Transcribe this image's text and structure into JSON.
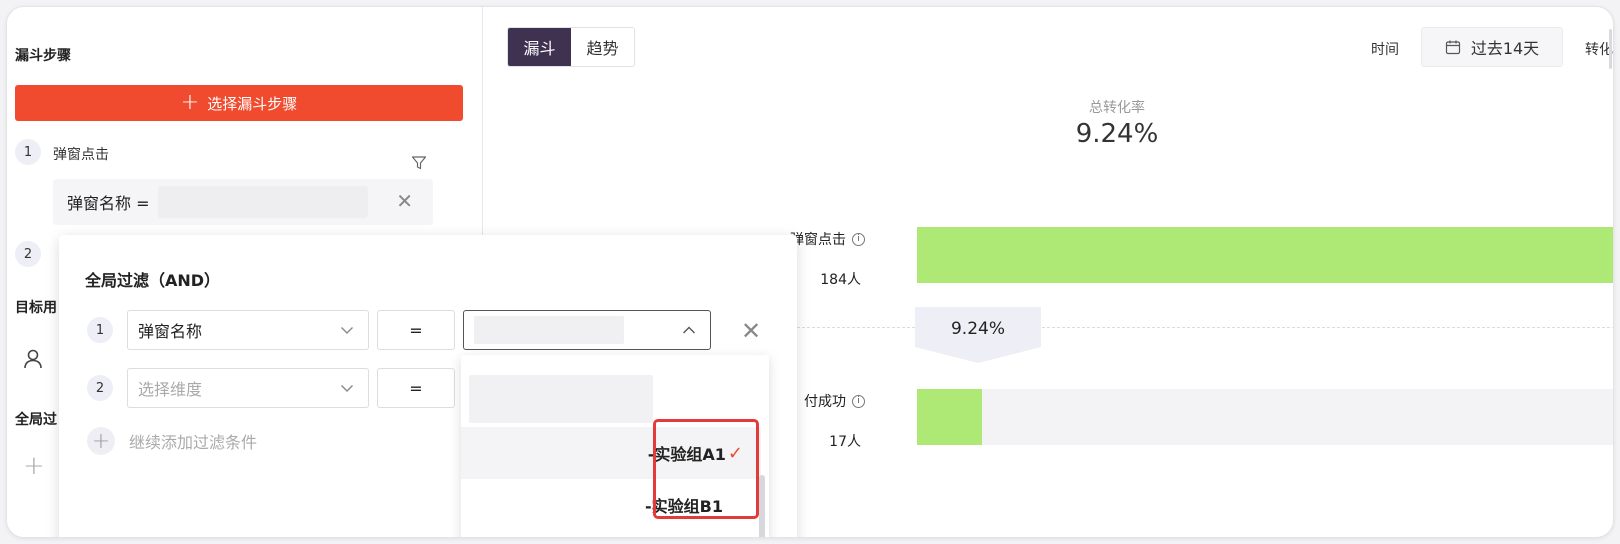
{
  "left": {
    "funnel_steps_title": "漏斗步骤",
    "add_step_button": "选择漏斗步骤",
    "step1": {
      "num": "1",
      "name": "弹窗点击",
      "condition_key": "弹窗名称 ="
    },
    "step2": {
      "num": "2"
    },
    "target_users_title": "目标用",
    "global_filter_title": "全局过"
  },
  "right": {
    "tabs": [
      {
        "label": "漏斗",
        "active": true
      },
      {
        "label": "趋势",
        "active": false
      }
    ],
    "time_label": "时间",
    "date_range": "过去14天",
    "conv_label": "转化",
    "total_caption": "总转化率",
    "total_value": "9.24%",
    "steps": [
      {
        "label": "弹窗点击",
        "count": "184人",
        "fraction": 1.0
      },
      {
        "label": "付成功",
        "count": "17人",
        "fraction": 0.0924
      }
    ],
    "step_rate": "9.24%",
    "bar_color": "#aee875"
  },
  "popup": {
    "title": "全局过滤（AND）",
    "rows": [
      {
        "num": "1",
        "dimension": "弹窗名称",
        "operator": "="
      },
      {
        "num": "2",
        "dimension_placeholder": "选择维度",
        "operator": "="
      }
    ],
    "add_condition": "继续添加过滤条件",
    "dropdown_items": [
      {
        "label": "-实验组A1",
        "selected": true
      },
      {
        "label": "-实验组B1",
        "selected": false
      }
    ],
    "check_mark": "✓",
    "accent": "#f04a2f",
    "highlight": "#e43a3a"
  }
}
